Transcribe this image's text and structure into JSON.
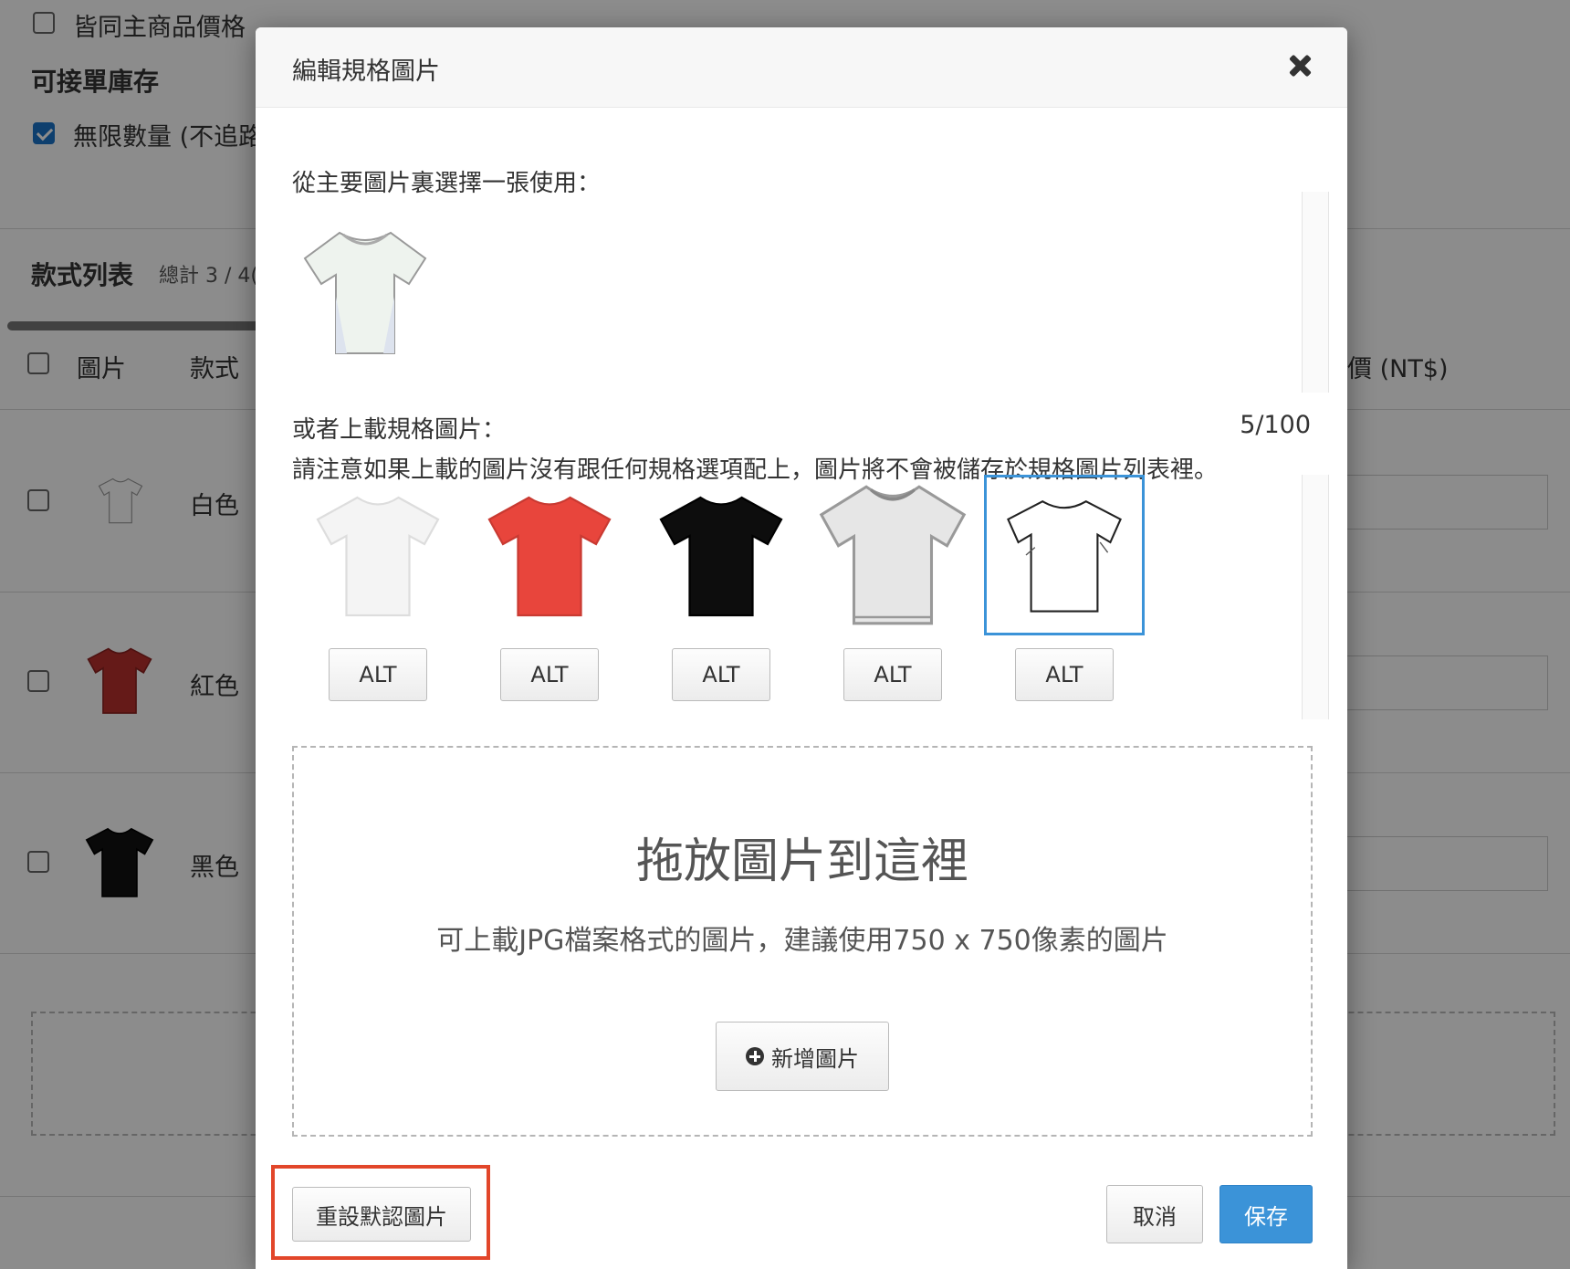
{
  "background": {
    "same_price_label": "皆同主商品價格",
    "stock_heading": "可接單庫存",
    "unlimited_label": "無限數量 (不追路",
    "variant_list_title": "款式列表",
    "variant_total": "總計 3 / 4(",
    "col_image": "圖片",
    "col_variant": "款式",
    "col_price": "價 (NT$)",
    "rows": [
      {
        "name": "白色",
        "shirt_color": "#ffffff"
      },
      {
        "name": "紅色",
        "shirt_color": "#b8302d"
      },
      {
        "name": "黑色",
        "shirt_color": "#111111"
      }
    ]
  },
  "modal": {
    "title": "編輯規格圖片",
    "choose_from_main": "從主要圖片裏選擇一張使用：",
    "or_upload": "或者上載規格圖片：",
    "count": "5/100",
    "notice": "請注意如果上載的圖片沒有跟任何規格選項配上，圖片將不會被儲存於規格圖片列表裡。",
    "thumbnails": [
      {
        "color": "#f4f4f4",
        "alt_label": "ALT"
      },
      {
        "color": "#e8453c",
        "alt_label": "ALT"
      },
      {
        "color": "#0d0d0d",
        "alt_label": "ALT"
      },
      {
        "color": "#e6e6e6",
        "alt_label": "ALT"
      },
      {
        "color": "#ffffff",
        "alt_label": "ALT"
      }
    ],
    "selected_index": 4,
    "dropzone": {
      "title": "拖放圖片到這裡",
      "hint": "可上載JPG檔案格式的圖片，建議使用750 x 750像素的圖片",
      "add_button": "新增圖片"
    },
    "reset_button": "重設默認圖片",
    "cancel_button": "取消",
    "save_button": "保存",
    "accent_color": "#3b93d8",
    "highlight_color": "#e2462a"
  }
}
